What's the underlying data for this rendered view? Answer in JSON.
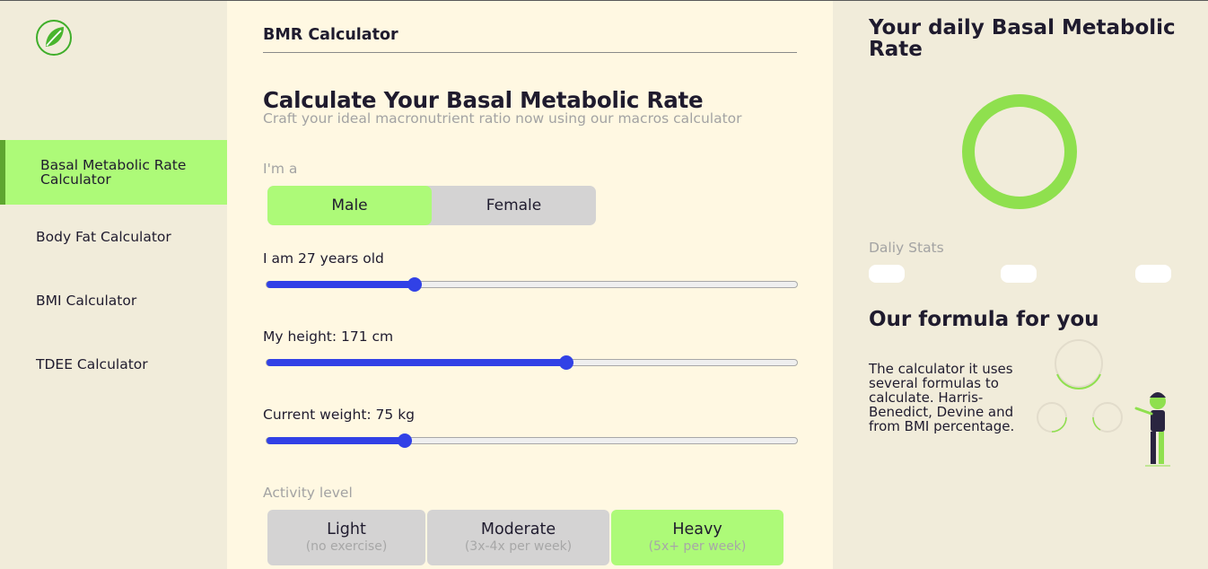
{
  "app": {
    "logo_icon": "leaf-logo-icon",
    "accent_color": "#adfa78",
    "slider_color": "#3141e6"
  },
  "sidebar": {
    "items": [
      {
        "label": "Basal Metabolic Rate Calculator",
        "active": true
      },
      {
        "label": "Body Fat Calculator",
        "active": false
      },
      {
        "label": "BMI Calculator",
        "active": false
      },
      {
        "label": "TDEE Calculator",
        "active": false
      }
    ]
  },
  "main": {
    "header_title": "BMR Calculator",
    "title": "Calculate Your Basal Metabolic Rate",
    "subtitle": "Craft your ideal macronutrient ratio now using our macros calculator",
    "gender": {
      "label": "I'm a",
      "options": [
        "Male",
        "Female"
      ],
      "selected": "Male"
    },
    "age": {
      "label": "I am 27 years old",
      "value_fraction": 0.28
    },
    "height": {
      "label": "My height: 171 cm",
      "value_fraction": 0.565
    },
    "weight": {
      "label": "Current weight: 75 kg",
      "value_fraction": 0.26
    },
    "activity": {
      "label": "Activity level",
      "options": [
        {
          "title": "Light",
          "sub": "(no exercise)"
        },
        {
          "title": "Moderate",
          "sub": "(3x-4x per week)"
        },
        {
          "title": "Heavy",
          "sub": "(5x+ per week)"
        }
      ],
      "selected": "Heavy"
    }
  },
  "results": {
    "title": "Your daily Basal Metabolic Rate",
    "stats_label": "Daliy Stats",
    "formula_title": "Our formula for you",
    "formula_text": "The calculator it uses several formulas to calculate. Harris-Benedict, Devine and from BMI percentage.",
    "illustration_icon": "fitness-person-illustration-icon"
  }
}
